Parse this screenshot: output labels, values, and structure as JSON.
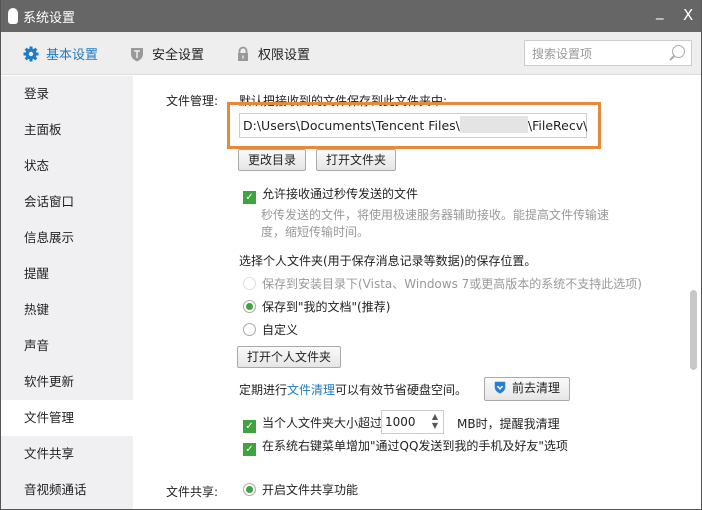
{
  "window": {
    "title": "系统设置",
    "minimize": "_",
    "close": "X"
  },
  "toolbar": {
    "tabs": [
      {
        "label": "基本设置",
        "icon": "gear-icon"
      },
      {
        "label": "安全设置",
        "icon": "shield-icon"
      },
      {
        "label": "权限设置",
        "icon": "lock-icon"
      }
    ],
    "search_placeholder": "搜索设置项"
  },
  "sidebar": {
    "items": [
      "登录",
      "主面板",
      "状态",
      "会话窗口",
      "信息展示",
      "提醒",
      "热键",
      "声音",
      "软件更新",
      "文件管理",
      "文件共享",
      "音视频通话"
    ],
    "active": "文件管理"
  },
  "file_mgmt": {
    "label": "文件管理:",
    "default_desc": "默认把接收到的文件保存到此文件夹中:",
    "path_prefix": "D:\\Users\\Documents\\Tencent Files\\",
    "path_suffix": "\\FileRecv\\",
    "change_dir": "更改目录",
    "open_folder": "打开文件夹",
    "allow_fast": "允许接收通过秒传发送的文件",
    "fast_desc1": "秒传发送的文件，将使用极速服务器辅助接收。能提高文件传输速",
    "fast_desc2": "度，缩短传输时间。",
    "personal_title": "选择个人文件夹(用于保存消息记录等数据)的保存位置。",
    "opt_install": "保存到安装目录下(Vista、Windows 7或更高版本的系统不支持此选项)",
    "opt_mydocs": "保存到\"我的文档\"(推荐)",
    "opt_custom": "自定义",
    "open_personal": "打开个人文件夹",
    "clean_pre": "定期进行",
    "clean_link": "文件清理",
    "clean_post": "可以有效节省硬盘空间。",
    "clean_btn": "前去清理",
    "size_pre": "当个人文件夹大小超过",
    "size_value": "1000",
    "size_post": "MB时，提醒我清理",
    "context_menu": "在系统右键菜单增加\"通过QQ发送到我的手机及好友\"选项"
  },
  "file_share": {
    "label": "文件共享:",
    "enable": "开启文件共享功能"
  },
  "colors": {
    "accent": "#1e7bc6",
    "highlight": "#e8893a",
    "check": "#3fa33f"
  }
}
